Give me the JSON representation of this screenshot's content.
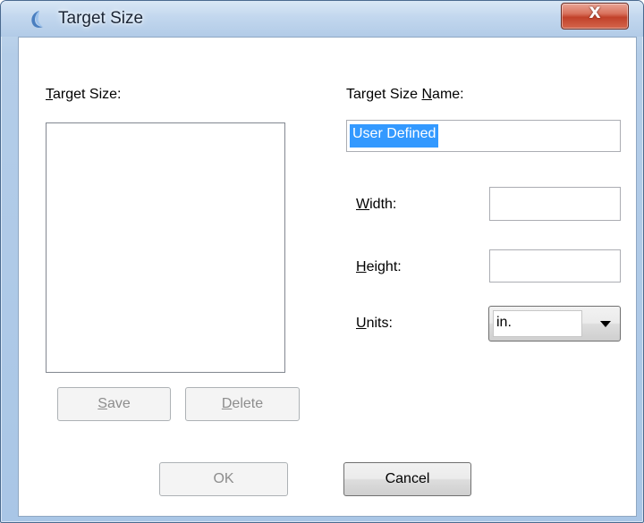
{
  "window": {
    "title": "Target Size",
    "icon": "app-icon",
    "close_label": "X"
  },
  "left": {
    "list_label_mnemonic": "T",
    "list_label_rest": "arget Size:",
    "items": [],
    "save": {
      "mnemonic": "S",
      "rest": "ave",
      "enabled": false
    },
    "delete": {
      "mnemonic": "D",
      "rest": "elete",
      "enabled": false
    }
  },
  "right": {
    "name_label_before": "Target Size ",
    "name_label_mnemonic": "N",
    "name_label_after": "ame:",
    "name_value": "User Defined",
    "width_mnemonic": "W",
    "width_rest": "idth:",
    "width_value": "",
    "height_mnemonic": "H",
    "height_rest": "eight:",
    "height_value": "",
    "units_mnemonic": "U",
    "units_rest": "nits:",
    "units_value": "in."
  },
  "footer": {
    "ok_label": "OK",
    "ok_enabled": false,
    "cancel_label": "Cancel"
  },
  "colors": {
    "selection": "#3399ff",
    "close_button": "#c1412a",
    "frame": "#b4cde8"
  }
}
